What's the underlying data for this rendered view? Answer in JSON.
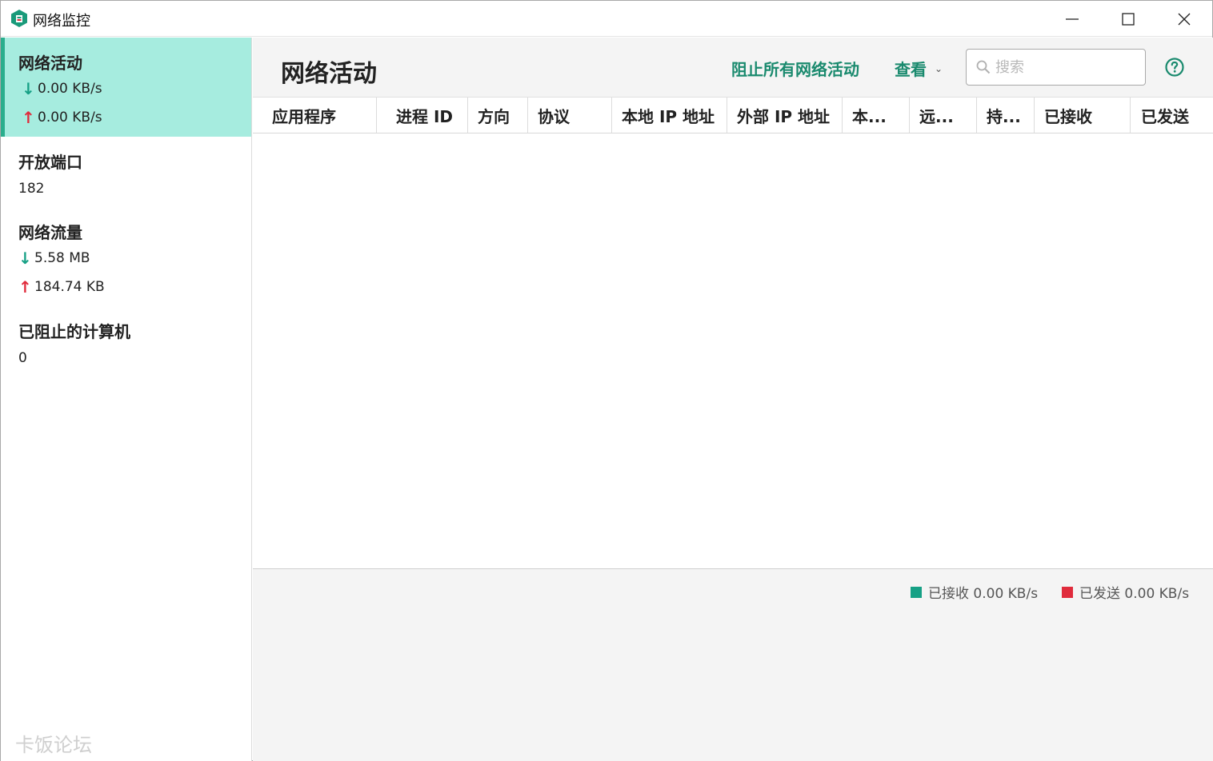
{
  "window": {
    "title": "网络监控"
  },
  "sidebar": {
    "network_activity": {
      "title": "网络活动",
      "download": "0.00 KB/s",
      "upload": "0.00 KB/s"
    },
    "open_ports": {
      "title": "开放端口",
      "value": "182"
    },
    "network_traffic": {
      "title": "网络流量",
      "download": "5.58 MB",
      "upload": "184.74 KB"
    },
    "blocked_computers": {
      "title": "已阻止的计算机",
      "value": "0"
    },
    "watermark": "卡饭论坛"
  },
  "header": {
    "title": "网络活动",
    "block_all": "阻止所有网络活动",
    "view": "查看",
    "search_placeholder": "搜索"
  },
  "table": {
    "columns": [
      "应用程序",
      "进程 ID",
      "方向",
      "协议",
      "本地 IP 地址",
      "外部 IP 地址",
      "本...",
      "远...",
      "持...",
      "已接收",
      "已发送"
    ],
    "rows": []
  },
  "graph": {
    "received_label": "已接收 0.00 KB/s",
    "sent_label": "已发送 0.00 KB/s"
  },
  "colors": {
    "accent": "#1a8a6e",
    "active_bg": "#a6ecdf",
    "download": "#16a085",
    "upload": "#e02b3c"
  }
}
